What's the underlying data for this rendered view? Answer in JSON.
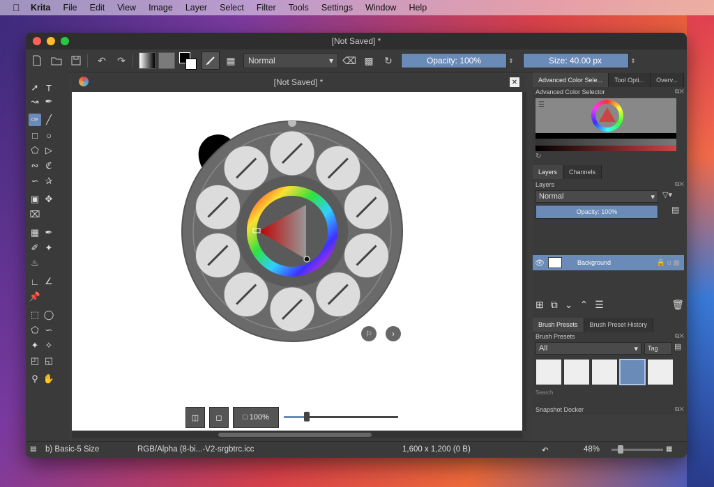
{
  "menubar": {
    "app": "Krita",
    "items": [
      "File",
      "Edit",
      "View",
      "Image",
      "Layer",
      "Select",
      "Filter",
      "Tools",
      "Settings",
      "Window",
      "Help"
    ]
  },
  "window": {
    "title": "[Not Saved]  *"
  },
  "toolbar": {
    "blend_mode": "Normal",
    "opacity": "Opacity: 100%",
    "size": "Size: 40.00 px"
  },
  "document": {
    "title": "[Not Saved]  *"
  },
  "popup_palette": {
    "zoom_label": "100%",
    "zoom_value": 0.2,
    "brushes": [
      "brush-1",
      "brush-2",
      "brush-3",
      "brush-4",
      "brush-5",
      "brush-6",
      "brush-7",
      "brush-8",
      "brush-9",
      "brush-10"
    ]
  },
  "dock": {
    "color_tabs": [
      "Advanced Color Sele...",
      "Tool Opti...",
      "Overv..."
    ],
    "color_title": "Advanced Color Selector",
    "layers_tabs": [
      "Layers",
      "Channels"
    ],
    "layers_title": "Layers",
    "layer_blend": "Normal",
    "layer_opacity": "Opacity:  100%",
    "layer_name": "Background",
    "preset_tabs": [
      "Brush Presets",
      "Brush Preset History"
    ],
    "preset_title": "Brush Presets",
    "preset_filter": "All",
    "preset_tag": "Tag",
    "search_placeholder": "Search",
    "snapshot_title": "Snapshot Docker"
  },
  "status": {
    "brush": "b) Basic-5 Size",
    "color_profile": "RGB/Alpha (8-bi...-V2-srgbtrc.icc",
    "dimensions": "1,600 x 1,200 (0 B)",
    "zoom": "48%",
    "zoom_value": 0.12
  },
  "colors": {
    "accent": "#6a8ab8",
    "window_bg": "#3c3c3c",
    "canvas": "#ffffff"
  }
}
